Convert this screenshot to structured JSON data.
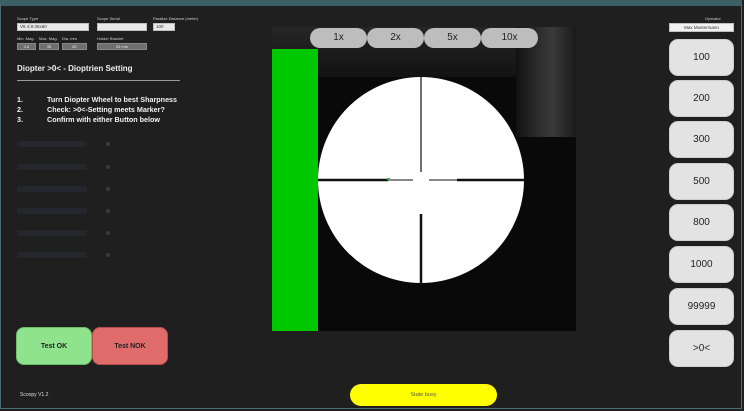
{
  "header": {
    "scope_type_label": "Scope Type",
    "scope_type_value": "V8 4.8-35x60",
    "scope_serial_label": "Scope Serial",
    "scope_serial_value": "",
    "parallax_label": "Parallax Distance (meter)",
    "parallax_value": "100",
    "min_mag_label": "Min. Mag.",
    "min_mag_value": "4.8",
    "max_mag_label": "Max. Mag.",
    "max_mag_value": "35",
    "dia_label": "Dia. mm",
    "dia_value": "60",
    "holder_label": "Holder Bracket",
    "holder_value": "34 mm"
  },
  "section": {
    "title": "Diopter >0< - Dioptrien Setting",
    "steps": [
      {
        "num": "1.",
        "text": "Turn Diopter Wheel to best Sharpness"
      },
      {
        "num": "2.",
        "text": "Check: >0<-Setting meets Marker?"
      },
      {
        "num": "3.",
        "text": "Confirm with either Button below"
      }
    ]
  },
  "actions": {
    "ok_label": "Test OK",
    "nok_label": "Test NOK"
  },
  "footer": {
    "version": "Scoopy V1.2",
    "status": "State busy"
  },
  "zoom_buttons": [
    "1x",
    "2x",
    "5x",
    "10x"
  ],
  "operator": {
    "label": "Operator",
    "value": "Max Mustermann"
  },
  "distance_buttons": [
    "100",
    "200",
    "300",
    "500",
    "800",
    "1000",
    "99999",
    ">0<"
  ],
  "colors": {
    "background": "#1f1f1f",
    "green_bar": "#00c800",
    "ok_button": "#8ee38c",
    "nok_button": "#e06b6b",
    "status_bar": "#ffff00",
    "side_button": "#e3e3e3"
  }
}
